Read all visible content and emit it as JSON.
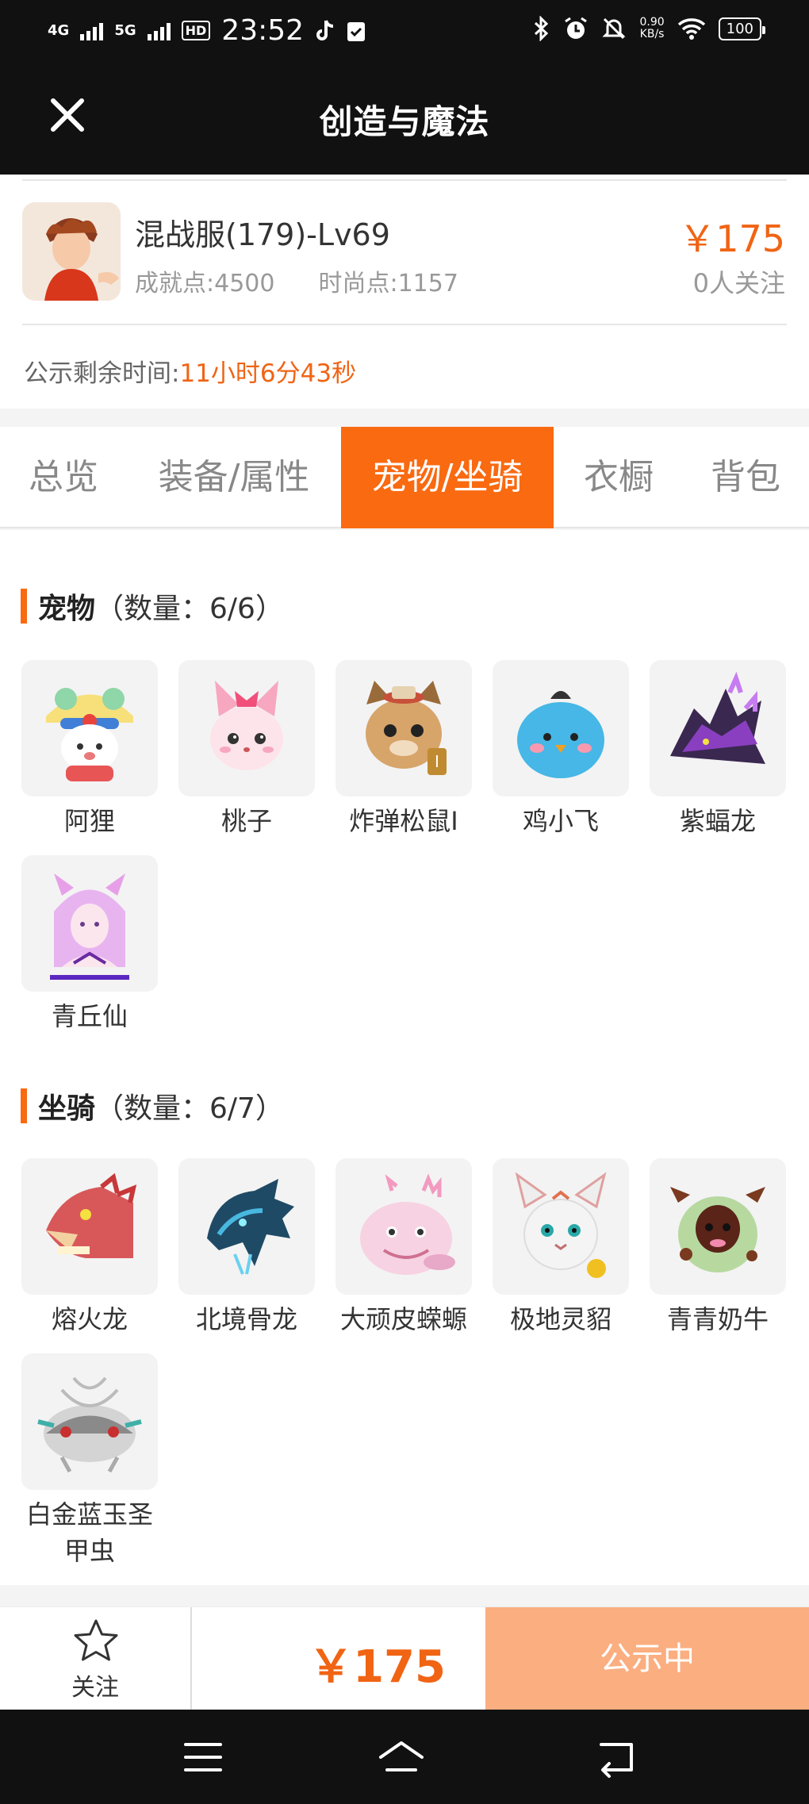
{
  "status_bar": {
    "network_1": "4G",
    "network_2": "5G",
    "hd_label": "HD",
    "time": "23:52",
    "speed_value": "0.90",
    "speed_unit": "KB/s",
    "battery": "100"
  },
  "header": {
    "title": "创造与魔法"
  },
  "listing": {
    "server": "混战服(179)-Lv69",
    "achievement": "成就点:4500",
    "fashion": "时尚点:1157",
    "price": "￥175",
    "followers": "0人关注",
    "countdown_label": "公示剩余时间:",
    "countdown_value": "11小时6分43秒"
  },
  "tabs": [
    {
      "label": "总览"
    },
    {
      "label": "装备/属性"
    },
    {
      "label": "宠物/坐骑"
    },
    {
      "label": "衣橱"
    },
    {
      "label": "背包"
    }
  ],
  "pets": {
    "title": "宠物",
    "count": "（数量：6/6）",
    "items": [
      {
        "name": "阿狸"
      },
      {
        "name": "桃子"
      },
      {
        "name": "炸弹松鼠Ⅰ"
      },
      {
        "name": "鸡小飞"
      },
      {
        "name": "紫蝠龙"
      },
      {
        "name": "青丘仙"
      }
    ]
  },
  "mounts": {
    "title": "坐骑",
    "count": "（数量：6/7）",
    "items": [
      {
        "name": "熔火龙"
      },
      {
        "name": "北境骨龙"
      },
      {
        "name": "大顽皮蝾螈"
      },
      {
        "name": "极地灵貂"
      },
      {
        "name": "青青奶牛"
      },
      {
        "name": "白金蓝玉圣甲虫"
      }
    ]
  },
  "bottom": {
    "follow_label": "关注",
    "price": "￥175",
    "status_button": "公示中"
  },
  "colors": {
    "accent": "#f96a11",
    "price": "#f06414",
    "button_disabled": "#fbae80"
  }
}
